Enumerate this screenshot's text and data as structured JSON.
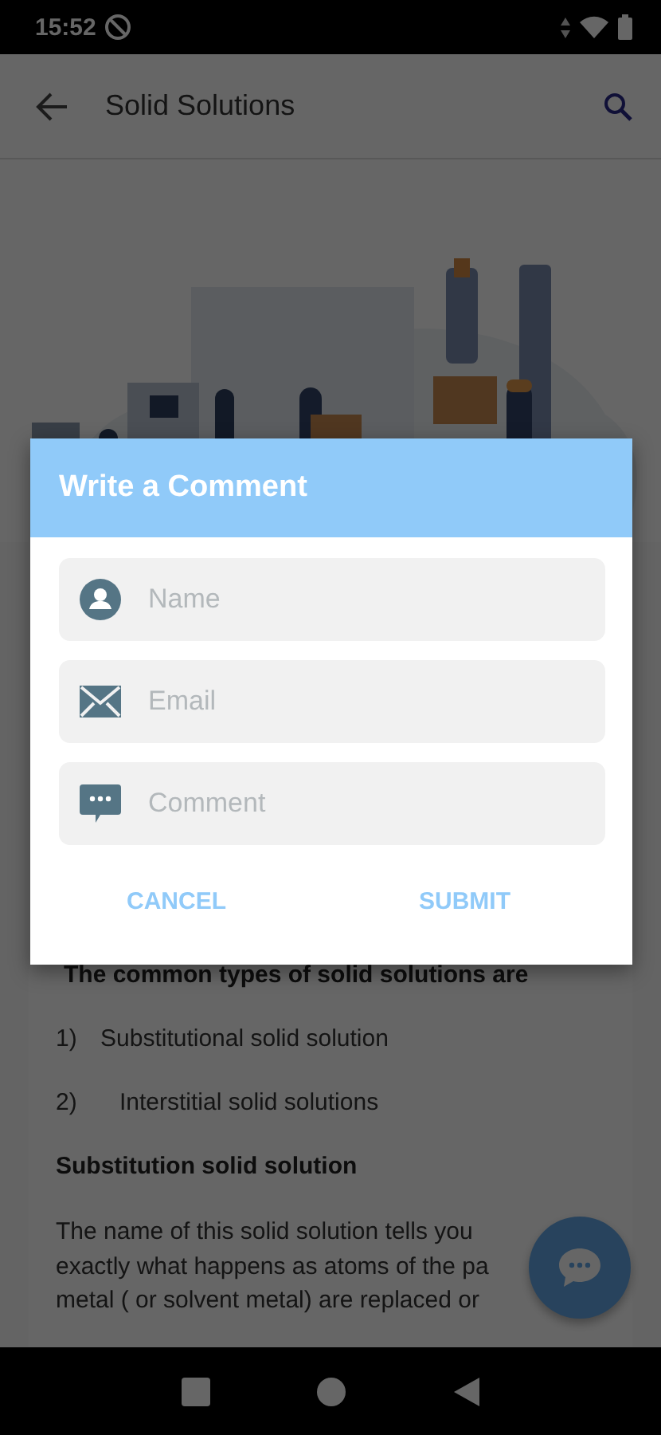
{
  "status_bar": {
    "time": "15:52"
  },
  "app_bar": {
    "title": "Solid Solutions"
  },
  "article": {
    "heading": "The common types of solid solutions are",
    "list": [
      {
        "number": "1)",
        "text": "Substitutional solid solution"
      },
      {
        "number": "2)",
        "text": "Interstitial solid solutions"
      }
    ],
    "subheading": "Substitution solid solution",
    "paragraph_lines": [
      "The name of this solid solution tells you",
      "exactly what happens as atoms of the pa",
      "metal ( or solvent metal) are replaced or"
    ]
  },
  "dialog": {
    "title": "Write a Comment",
    "fields": [
      {
        "kind": "name",
        "placeholder": "Name"
      },
      {
        "kind": "email",
        "placeholder": "Email"
      },
      {
        "kind": "comment",
        "placeholder": "Comment"
      }
    ],
    "buttons": [
      "CANCEL",
      "SUBMIT"
    ]
  }
}
